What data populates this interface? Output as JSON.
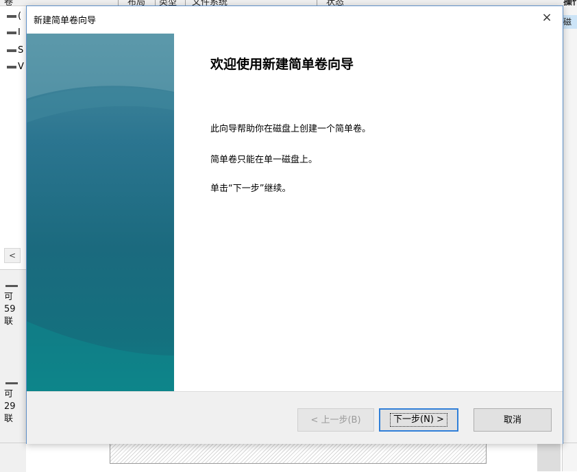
{
  "background": {
    "columns": [
      "卷",
      "布局",
      "类型",
      "文件系统",
      "状态",
      "操作"
    ],
    "volume_glyphs": [
      "(",
      "I",
      "S",
      "V"
    ],
    "scroll_left": "<",
    "disks": [
      {
        "line1": "可",
        "line2": "59",
        "line3": "联"
      },
      {
        "line1": "可",
        "line2": "29",
        "line3": "联"
      }
    ],
    "right_item": "磁"
  },
  "dialog": {
    "title": "新建简单卷向导",
    "close_symbol": "×",
    "heading": "欢迎使用新建简单卷向导",
    "body": [
      "此向导帮助你在磁盘上创建一个简单卷。",
      "简单卷只能在单一磁盘上。",
      "单击“下一步”继续。"
    ],
    "buttons": {
      "back": "< 上一步(B)",
      "next": "下一步(N) >",
      "cancel": "取消"
    }
  },
  "colors": {
    "banner_top": "#4c8ea0",
    "banner_bottom": "#0f7f86",
    "dialog_border": "#5c8ec7",
    "default_button_border": "#2f7ed8"
  }
}
